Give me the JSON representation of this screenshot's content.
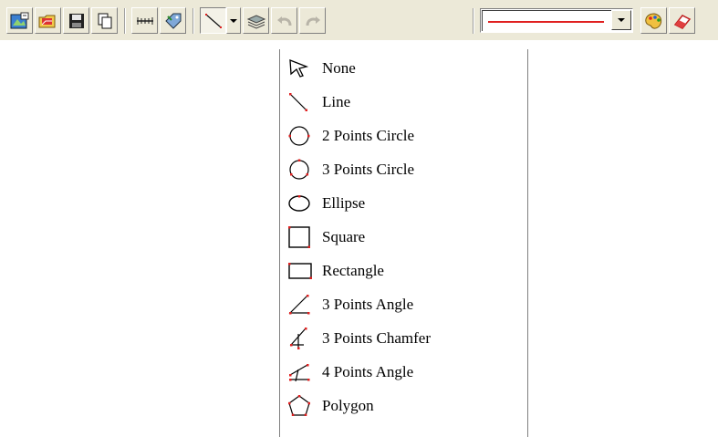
{
  "toolbar": {
    "buttons": [
      {
        "name": "new-image-button",
        "icon": "new-image-icon"
      },
      {
        "name": "open-folder-button",
        "icon": "open-folder-icon"
      },
      {
        "name": "save-button",
        "icon": "floppy-disk-icon"
      },
      {
        "name": "copy-button",
        "icon": "copy-icon"
      },
      {
        "name": "calibrate-button",
        "icon": "ruler-icon"
      },
      {
        "name": "measure-tag-button",
        "icon": "tag-icon"
      },
      {
        "name": "draw-shape-button",
        "icon": "line-tool-icon"
      },
      {
        "name": "shape-dropdown-button",
        "icon": "dropdown-arrow-icon"
      },
      {
        "name": "layers-button",
        "icon": "layers-icon"
      },
      {
        "name": "undo-button",
        "icon": "undo-icon"
      },
      {
        "name": "redo-button",
        "icon": "redo-icon"
      },
      {
        "name": "color-palette-button",
        "icon": "palette-icon"
      },
      {
        "name": "eraser-button",
        "icon": "eraser-icon"
      }
    ],
    "line_style": {
      "color": "#e02020"
    }
  },
  "shape_menu": {
    "items": [
      {
        "label": "None",
        "icon": "pointer-icon"
      },
      {
        "label": "Line",
        "icon": "line-icon"
      },
      {
        "label": "2 Points Circle",
        "icon": "circle-2pt-icon"
      },
      {
        "label": "3 Points Circle",
        "icon": "circle-3pt-icon"
      },
      {
        "label": "Ellipse",
        "icon": "ellipse-icon"
      },
      {
        "label": "Square",
        "icon": "square-icon"
      },
      {
        "label": "Rectangle",
        "icon": "rectangle-icon"
      },
      {
        "label": "3 Points Angle",
        "icon": "angle-3pt-icon"
      },
      {
        "label": "3 Points Chamfer",
        "icon": "chamfer-3pt-icon"
      },
      {
        "label": "4 Points Angle",
        "icon": "angle-4pt-icon"
      },
      {
        "label": "Polygon",
        "icon": "polygon-icon"
      }
    ]
  },
  "colors": {
    "accent_red": "#e02020",
    "toolbar_bg": "#ece9d8"
  }
}
